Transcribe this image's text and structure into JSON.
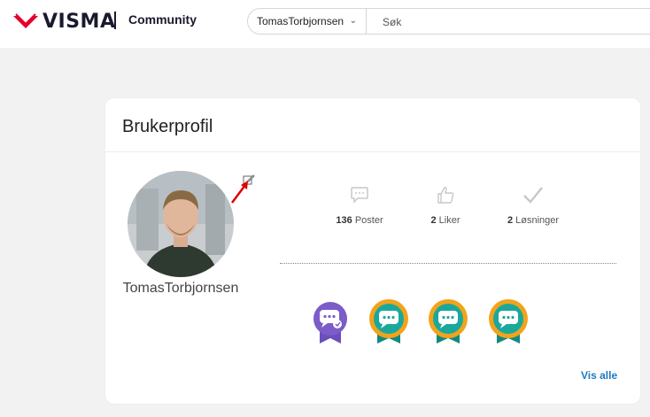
{
  "header": {
    "logo_text": "VISMA",
    "site_name": "Community",
    "search_scope": "TomasTorbjornsen",
    "search_placeholder": "Søk"
  },
  "profile": {
    "title": "Brukerprofil",
    "username": "TomasTorbjornsen",
    "stats": [
      {
        "count": "136",
        "label": "Poster",
        "icon": "speech-bubble-icon"
      },
      {
        "count": "2",
        "label": "Liker",
        "icon": "thumbs-up-icon"
      },
      {
        "count": "2",
        "label": "Løsninger",
        "icon": "checkmark-icon"
      }
    ],
    "badges": [
      "purple-chat-badge",
      "teal-chat-laurel-badge",
      "teal-chat-laurel-badge",
      "teal-chat-laurel-badge"
    ],
    "view_all_label": "Vis alle"
  },
  "colors": {
    "brand_red": "#e4002b",
    "link_blue": "#1c7bbf",
    "badge_purple": "#6b4fbb",
    "badge_teal": "#1aa89c",
    "badge_gold": "#f2a31c"
  }
}
